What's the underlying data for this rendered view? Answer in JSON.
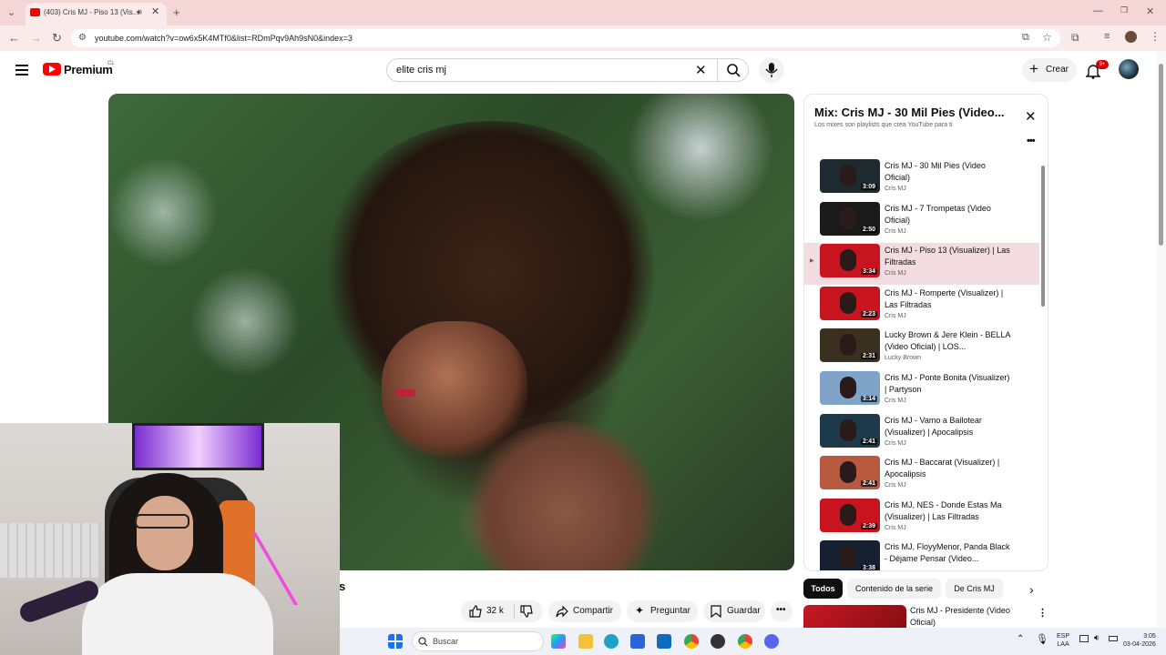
{
  "browser": {
    "tab_title": "(403) Cris MJ - Piso 13 (Vis...",
    "url": "youtube.com/watch?v=ow6x5K4MTf0&list=RDmPqv9Ah9sN0&index=3"
  },
  "header": {
    "brand": "Premium",
    "region": "CL",
    "search_value": "elite cris mj",
    "create_label": "Crear",
    "notifications_badge": "9+"
  },
  "video": {
    "title_fragment": "s"
  },
  "actions": {
    "likes": "32 k",
    "share": "Compartir",
    "ask": "Preguntar",
    "save": "Guardar"
  },
  "playlist": {
    "title": "Mix: Cris MJ - 30 Mil Pies (Video...",
    "subtitle": "Los mixes son playlists que crea YouTube para ti",
    "items": [
      {
        "title": "Cris MJ - 30 Mil Pies (Video Oficial)",
        "channel": "Cris MJ",
        "duration": "3:09",
        "color": "#1d2a30"
      },
      {
        "title": "Cris MJ - 7 Trompetas (Video Oficial)",
        "channel": "Cris MJ",
        "duration": "2:50",
        "color": "#1a1a1a"
      },
      {
        "title": "Cris MJ - Piso 13 (Visualizer) | Las Filtradas",
        "channel": "Cris MJ",
        "duration": "3:34",
        "color": "#c8141e"
      },
      {
        "title": "Cris MJ - Romperte (Visualizer) | Las Filtradas",
        "channel": "Cris MJ",
        "duration": "2:23",
        "color": "#c8141e"
      },
      {
        "title": "Lucky Brown & Jere Klein - BELLA (Video Oficial) | LOS...",
        "channel": "Lucky Brown",
        "duration": "2:31",
        "color": "#3a3020"
      },
      {
        "title": "Cris MJ - Ponte Bonita (Visualizer) | Partyson",
        "channel": "Cris MJ",
        "duration": "3:14",
        "color": "#7fa4c8"
      },
      {
        "title": "Cris MJ - Vamo a Bailotear (Visualizer) | Apocalipsis",
        "channel": "Cris MJ",
        "duration": "2:41",
        "color": "#1d3a4a"
      },
      {
        "title": "Cris MJ - Baccarat (Visualizer) | Apocalipsis",
        "channel": "Cris MJ",
        "duration": "2:41",
        "color": "#b85a40"
      },
      {
        "title": "Cris MJ, NES - Donde Estas Ma (Visualizer) | Las Filtradas",
        "channel": "Cris MJ",
        "duration": "2:39",
        "color": "#c8141e"
      },
      {
        "title": "Cris MJ, FloyyMenor, Panda Black - Déjame Pensar (Video...",
        "channel": "",
        "duration": "3:38",
        "color": "#152030"
      }
    ]
  },
  "chips": [
    "Todos",
    "Contenido de la serie",
    "De Cris MJ"
  ],
  "recommended": {
    "title": "Cris MJ - Presidente (Video Oficial)"
  },
  "taskbar": {
    "search_label": "Buscar",
    "lang_top": "ESP",
    "lang_bottom": "LAA",
    "time": "3:05",
    "date": "03-04-2026"
  }
}
